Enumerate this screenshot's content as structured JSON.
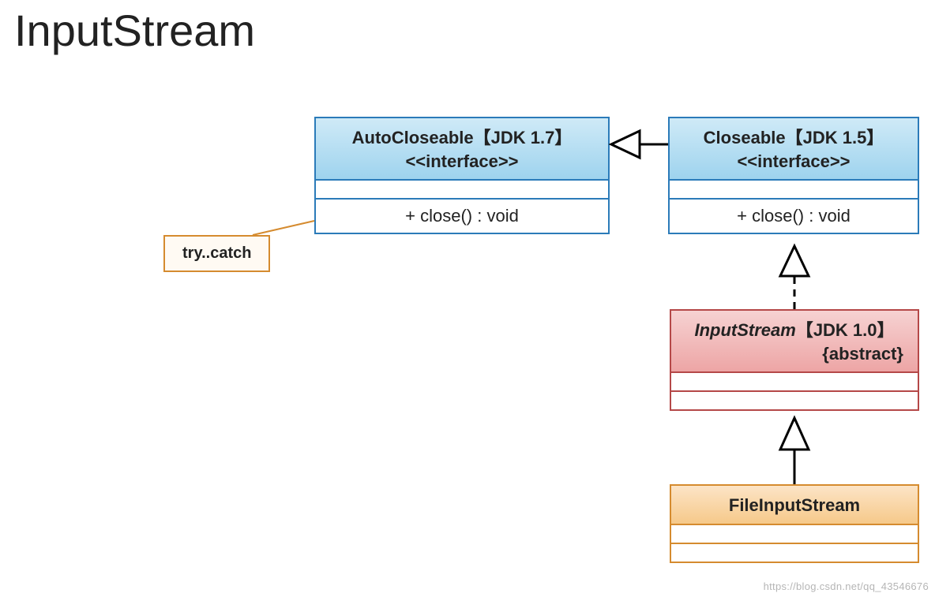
{
  "title": "InputStream",
  "boxes": {
    "autoCloseable": {
      "name": "AutoCloseable【JDK 1.7】",
      "stereotype": "<<interface>>",
      "method": "+ close() : void"
    },
    "closeable": {
      "name": "Closeable【JDK 1.5】",
      "stereotype": "<<interface>>",
      "method": "+ close() : void"
    },
    "inputStream": {
      "name": "InputStream【JDK 1.0】",
      "modifier": "{abstract}"
    },
    "fileInputStream": {
      "name": "FileInputStream"
    }
  },
  "note": {
    "text": "try..catch"
  },
  "watermark": "https://blog.csdn.net/qq_43546676",
  "relationships": [
    {
      "from": "Closeable",
      "to": "AutoCloseable",
      "type": "generalization-solid"
    },
    {
      "from": "InputStream",
      "to": "Closeable",
      "type": "realization-dashed"
    },
    {
      "from": "FileInputStream",
      "to": "InputStream",
      "type": "generalization-solid"
    },
    {
      "from": "note-try-catch",
      "to": "AutoCloseable",
      "type": "note-link"
    }
  ]
}
